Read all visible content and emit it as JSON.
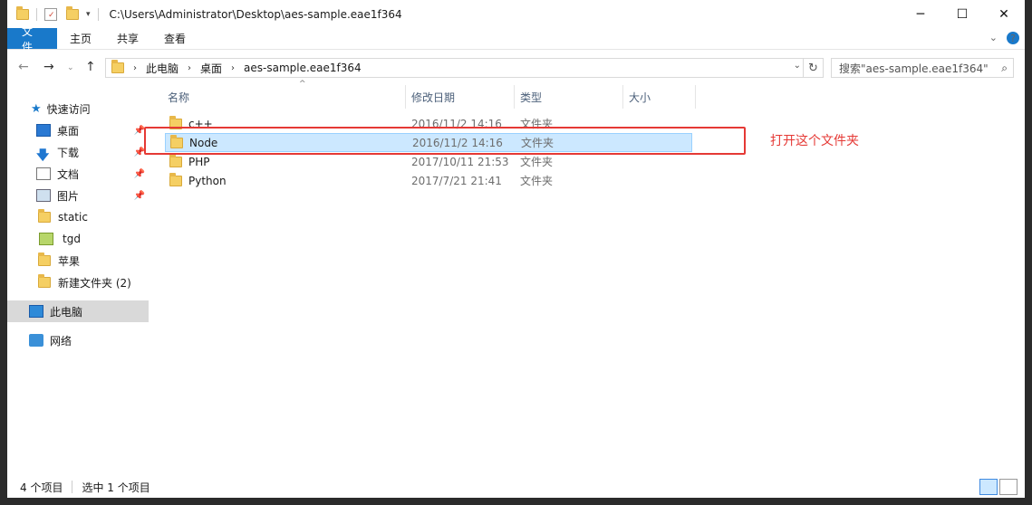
{
  "window": {
    "title_path": "C:\\Users\\Administrator\\Desktop\\aes-sample.eae1f364",
    "controls": {
      "minimize": "─",
      "maximize": "☐",
      "close": "✕"
    }
  },
  "ribbon": {
    "tabs": [
      "文件",
      "主页",
      "共享",
      "查看"
    ],
    "expand_icon": "chevron-down-icon",
    "help_icon": "?"
  },
  "address": {
    "crumbs": [
      "此电脑",
      "桌面",
      "aes-sample.eae1f364"
    ],
    "search_placeholder": "搜索\"aes-sample.eae1f364\""
  },
  "navpane": {
    "quick_access": "快速访问",
    "items": [
      {
        "label": "桌面",
        "pinned": true,
        "icon": "desktop-icon"
      },
      {
        "label": "下载",
        "pinned": true,
        "icon": "download-icon"
      },
      {
        "label": "文档",
        "pinned": true,
        "icon": "document-icon"
      },
      {
        "label": "图片",
        "pinned": true,
        "icon": "pictures-icon"
      },
      {
        "label": "static",
        "pinned": false,
        "icon": "folder-icon"
      },
      {
        "label": "tgd",
        "pinned": false,
        "icon": "folder-icon"
      },
      {
        "label": "苹果",
        "pinned": false,
        "icon": "folder-icon"
      },
      {
        "label": "新建文件夹 (2)",
        "pinned": false,
        "icon": "folder-icon"
      }
    ],
    "this_pc": "此电脑",
    "network": "网络"
  },
  "columns": {
    "name": "名称",
    "date": "修改日期",
    "type": "类型",
    "size": "大小"
  },
  "files": [
    {
      "name": "c++",
      "date": "2016/11/2 14:16",
      "type": "文件夹",
      "selected": false
    },
    {
      "name": "Node",
      "date": "2016/11/2 14:16",
      "type": "文件夹",
      "selected": true
    },
    {
      "name": "PHP",
      "date": "2017/10/11 21:53",
      "type": "文件夹",
      "selected": false
    },
    {
      "name": "Python",
      "date": "2017/7/21 21:41",
      "type": "文件夹",
      "selected": false
    }
  ],
  "annotation": {
    "text": "打开这个文件夹",
    "color": "#e53935"
  },
  "status": {
    "count": "4 个项目",
    "selection": "选中 1 个项目"
  },
  "colors": {
    "accent": "#1979ca",
    "selection": "#cce8ff",
    "annotation": "#e53935"
  }
}
